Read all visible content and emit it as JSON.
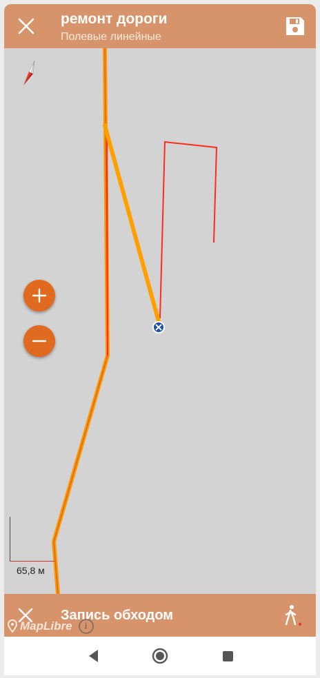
{
  "header": {
    "title": "ремонт дороги",
    "subtitle": "Полевые линейные"
  },
  "map": {
    "scale_label": "65,8 м",
    "attribution": "MapLibre"
  },
  "recording": {
    "label": "Запись обходом"
  },
  "colors": {
    "accent": "#d7946a",
    "zoom_button": "#e16a21",
    "track_orange": "#ffa000",
    "track_red": "#ff2a1a",
    "map_background": "#d3d3d3"
  },
  "icons": {
    "close": "close-icon",
    "save": "save-icon",
    "compass": "compass-icon",
    "zoom_in": "plus-icon",
    "zoom_out": "minus-icon",
    "walk": "walking-person-icon",
    "back": "back-icon",
    "home": "home-icon",
    "recents": "recents-icon"
  }
}
